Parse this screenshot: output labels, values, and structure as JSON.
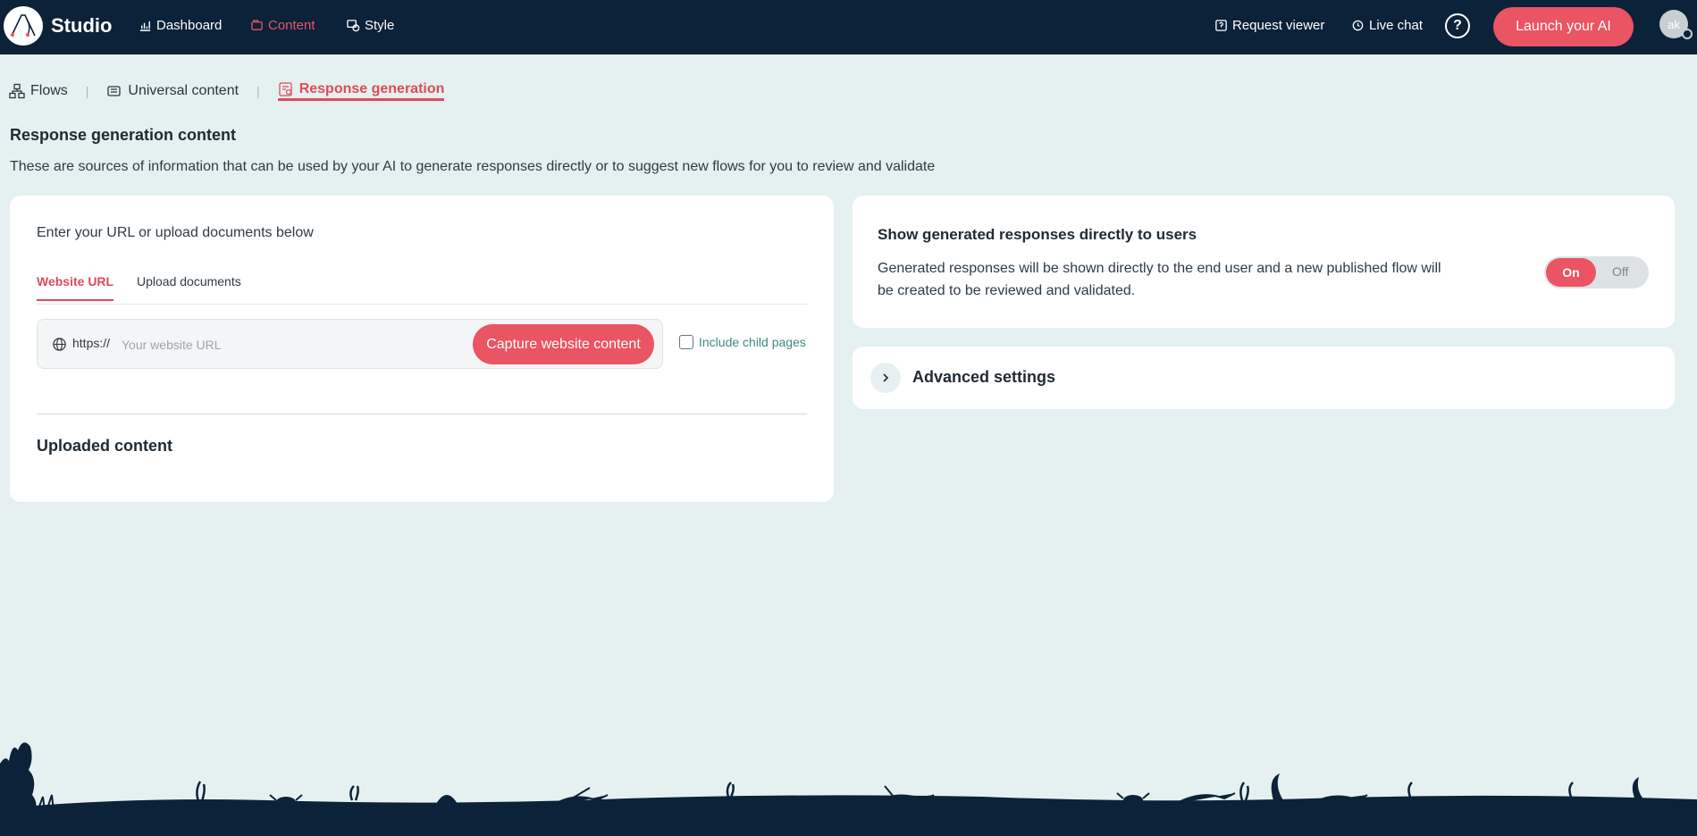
{
  "app": {
    "brand": "Studio",
    "nav": [
      {
        "label": "Dashboard",
        "icon": "chart-icon"
      },
      {
        "label": "Content",
        "icon": "content-icon",
        "active": true
      },
      {
        "label": "Style",
        "icon": "style-icon"
      }
    ],
    "right_nav": {
      "request_viewer": "Request viewer",
      "live_chat": "Live chat",
      "help": "?",
      "launch": "Launch your AI",
      "avatar": "ak"
    }
  },
  "subtabs": [
    {
      "label": "Flows",
      "icon": "flows-icon"
    },
    {
      "label": "Universal content",
      "icon": "universal-content-icon"
    },
    {
      "label": "Response generation",
      "icon": "response-generation-icon",
      "active": true
    }
  ],
  "page": {
    "title": "Response generation content",
    "description": "These are sources of information that can be used by your AI to generate responses directly or to suggest new flows for you to review and validate"
  },
  "source_card": {
    "intro": "Enter your URL or upload documents below",
    "tabs": [
      "Website URL",
      "Upload documents"
    ],
    "active_tab": "Website URL",
    "url_prefix": "https://",
    "url_value": "",
    "url_placeholder": "Your website URL",
    "capture_label": "Capture website content",
    "include_child_label": "Include child pages",
    "include_child_checked": false,
    "uploaded_title": "Uploaded content"
  },
  "toggle_card": {
    "title": "Show generated responses directly to users",
    "description": "Generated responses will be shown directly to the end user and a new published flow will be created to be reviewed and validated.",
    "on_label": "On",
    "off_label": "Off",
    "state": "On"
  },
  "advanced": {
    "label": "Advanced settings"
  },
  "colors": {
    "nav_bg": "#0b2238",
    "accent": "#ea5463",
    "page_bg": "#e4f1f0",
    "link_green": "#3f8a82"
  }
}
